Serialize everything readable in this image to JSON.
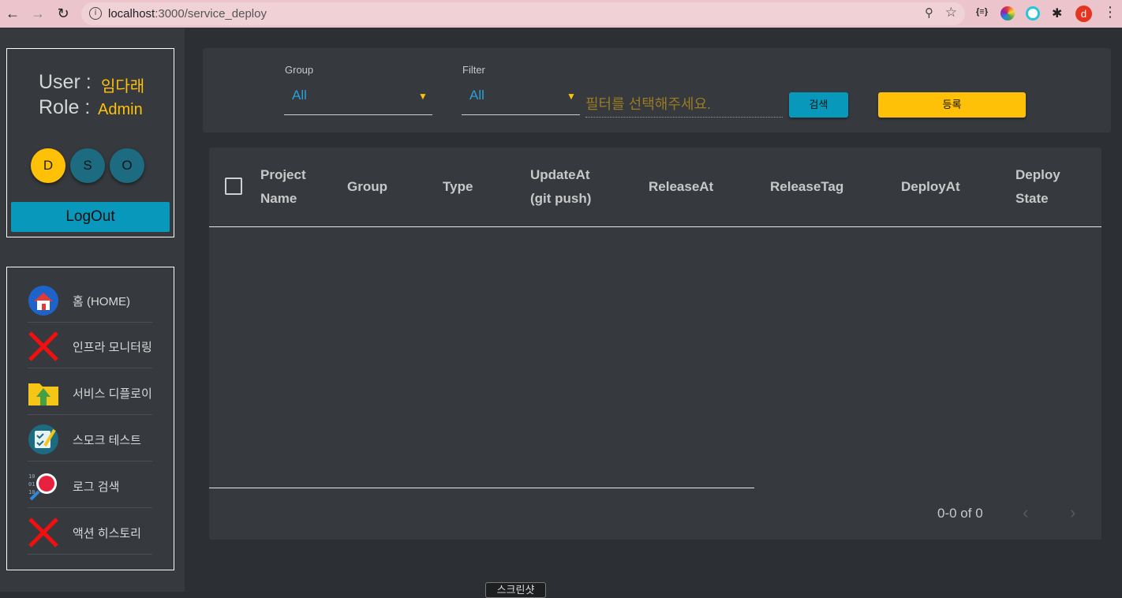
{
  "browser": {
    "url_host": "localhost",
    "url_path": ":3000/service_deploy",
    "profile_initial": "d",
    "ext_label": "{≡}"
  },
  "user": {
    "user_label": "User :",
    "user_name": "임다래",
    "role_label": "Role :",
    "role_name": "Admin",
    "circles": [
      "D",
      "S",
      "O"
    ],
    "logout_label": "LogOut"
  },
  "menu": [
    {
      "label": "홈 (HOME)",
      "icon": "home-icon"
    },
    {
      "label": "인프라 모니터링",
      "icon": "red-x-icon"
    },
    {
      "label": "서비스 디플로이",
      "icon": "folder-upload-icon"
    },
    {
      "label": "스모크 테스트",
      "icon": "checklist-icon"
    },
    {
      "label": "로그 검색",
      "icon": "log-search-icon"
    },
    {
      "label": "액션 히스토리",
      "icon": "red-x-icon"
    }
  ],
  "toolbar": {
    "group_label": "Group",
    "group_value": "All",
    "filter_label": "Filter",
    "filter_value": "All",
    "filter_placeholder": "필터를 선택해주세요.",
    "search_label": "검색",
    "register_label": "등록"
  },
  "table": {
    "columns": [
      {
        "line1": "Project",
        "line2": "Name"
      },
      {
        "line1": "Group",
        "line2": ""
      },
      {
        "line1": "Type",
        "line2": ""
      },
      {
        "line1": "UpdateAt",
        "line2": "(git push)"
      },
      {
        "line1": "ReleaseAt",
        "line2": ""
      },
      {
        "line1": "ReleaseTag",
        "line2": ""
      },
      {
        "line1": "DeployAt",
        "line2": ""
      },
      {
        "line1": "Deploy",
        "line2": "State"
      }
    ],
    "rows": [],
    "pagination": "0-0 of 0"
  },
  "bottom_tab_label": "스크린샷",
  "colors": {
    "accent_yellow": "#ffc107",
    "accent_blue": "#0898bb",
    "teal_circle": "#1d6b80"
  }
}
